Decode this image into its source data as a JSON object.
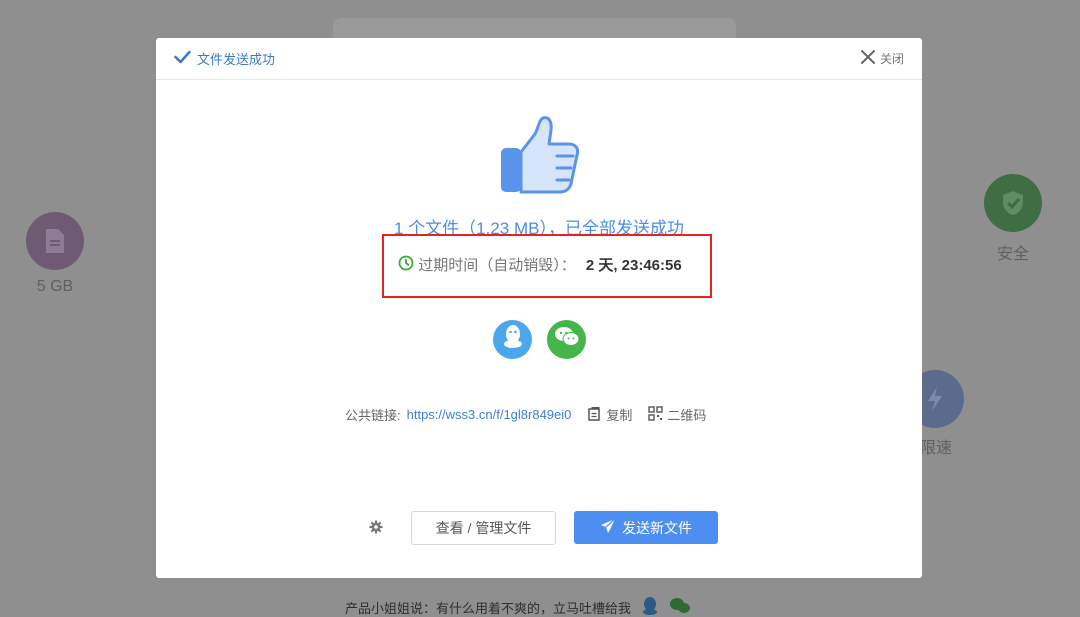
{
  "background": {
    "features": {
      "storage": {
        "label": "5 GB",
        "icon": "file-icon"
      },
      "safe": {
        "label": "安全",
        "icon": "shield-icon"
      },
      "speed": {
        "label": "限速",
        "icon": "lightning-icon"
      }
    },
    "footer_tip": "产品小姐姐说：有什么用着不爽的，立马吐槽给我"
  },
  "modal": {
    "title": "文件发送成功",
    "close_label": "关闭",
    "success_message": "1 个文件（1.23 MB），已全部发送成功",
    "expire_label": "过期时间（自动销毁）：",
    "expire_value": "2 天, 23:46:56",
    "share": {
      "qq": "qq-icon",
      "wechat": "wechat-icon"
    },
    "public_link_label": "公共链接:",
    "public_link_url": "https://wss3.cn/f/1gl8r849ei0",
    "copy_label": "复制",
    "qrcode_label": "二维码",
    "manage_button": "查看 / 管理文件",
    "send_button": "发送新文件"
  },
  "colors": {
    "accent": "#4d8ff0",
    "highlight": "#e32424",
    "wechat": "#44b549",
    "qq": "#4ba7ec"
  }
}
